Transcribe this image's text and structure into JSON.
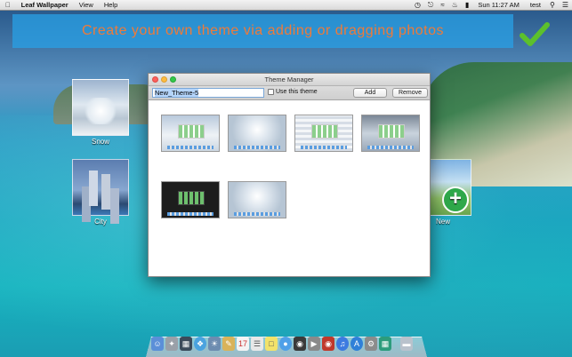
{
  "menubar": {
    "apple_label": "",
    "app_name": "Leaf Wallpaper",
    "menus": [
      "View",
      "Help"
    ],
    "clock": "Sun 11:27 AM",
    "user": "test"
  },
  "banner": {
    "text": "Create your own theme via adding or dragging photos"
  },
  "desktop_themes": [
    {
      "label": "Snow"
    },
    {
      "label": "City"
    },
    {
      "label": "New"
    }
  ],
  "window": {
    "title": "Theme Manager",
    "name_value": "New_Theme-5",
    "use_theme_label": "Use this theme",
    "add_label": "Add",
    "remove_label": "Remove"
  },
  "dock": {
    "icons": [
      "finder-icon",
      "launchpad-icon",
      "mission-control-icon",
      "safari-icon",
      "photo-icon",
      "notes-icon",
      "calendar-icon",
      "text-icon",
      "stickies-icon",
      "messages-icon",
      "facetime-icon",
      "quicktime-icon",
      "photobooth-icon",
      "itunes-icon",
      "appstore-icon",
      "preferences-icon",
      "leaf-wallpaper-icon",
      "trash-icon"
    ]
  },
  "colors": {
    "banner_text": "#f07a38",
    "banner_bg": "#28a0e6",
    "check": "#5cc02c"
  }
}
